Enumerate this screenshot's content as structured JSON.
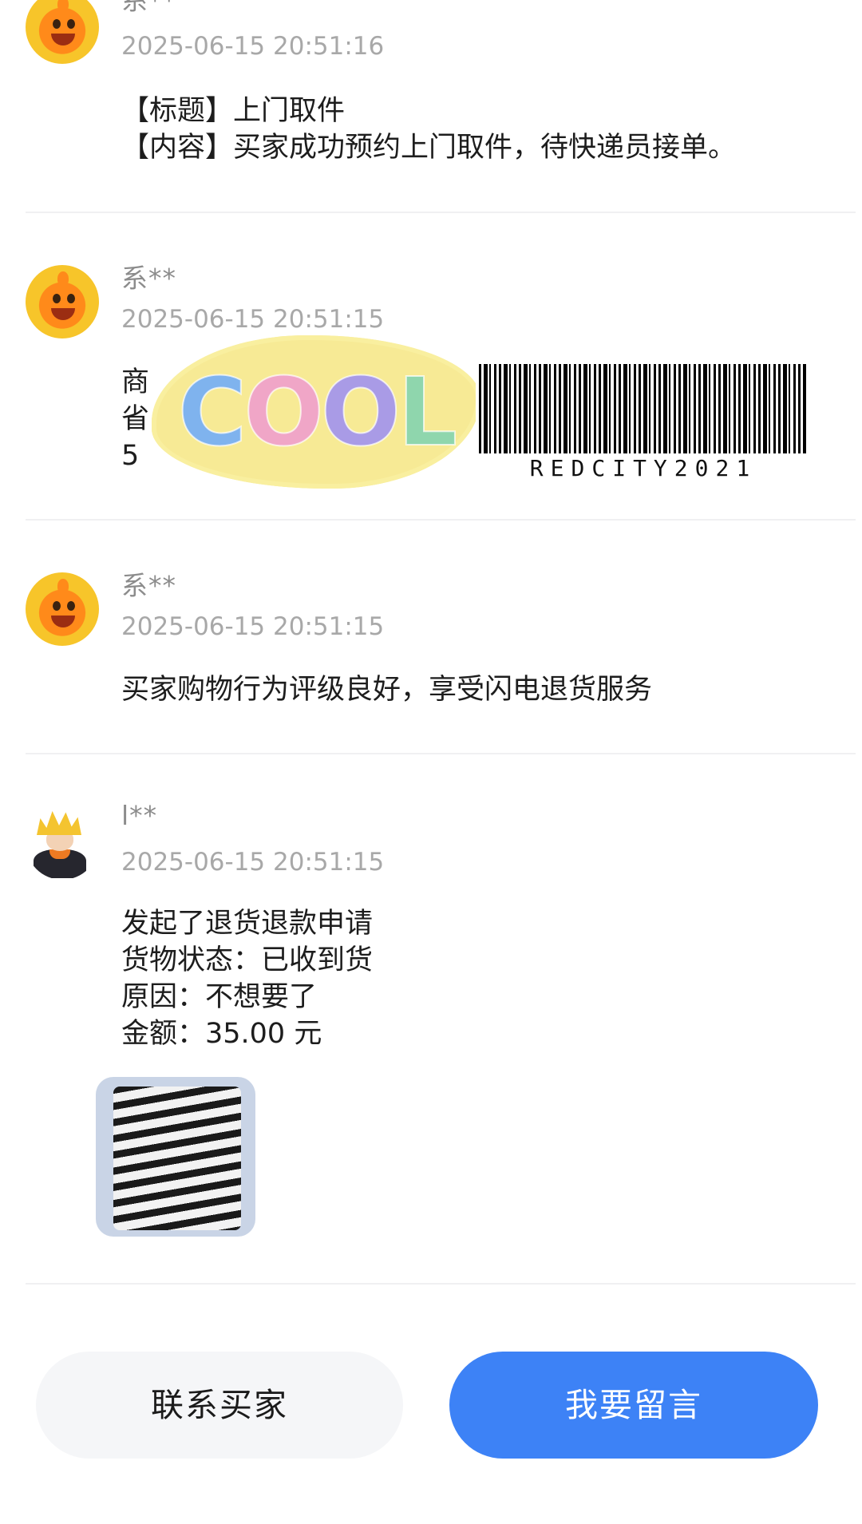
{
  "messages": [
    {
      "sender": "系**",
      "time": "2025-06-15 20:51:16",
      "lines": [
        "【标题】上门取件",
        "【内容】买家成功预约上门取件，待快递员接单。"
      ],
      "avatar": "orange-mascot-icon"
    },
    {
      "sender": "系**",
      "time": "2025-06-15 20:51:15",
      "lines": [
        "商",
        "省",
        "5"
      ],
      "avatar": "orange-mascot-icon"
    },
    {
      "sender": "系**",
      "time": "2025-06-15 20:51:15",
      "lines": [
        "买家购物行为评级良好，享受闪电退货服务"
      ],
      "avatar": "orange-mascot-icon"
    },
    {
      "sender": "l**",
      "time": "2025-06-15 20:51:15",
      "lines": [
        "发起了退货退款申请",
        "货物状态：已收到货",
        "原因：不想要了",
        "金额：35.00 元"
      ],
      "avatar": "ninja-avatar-icon"
    }
  ],
  "overlay": {
    "sticker_text": [
      "C",
      "O",
      "O",
      "L"
    ],
    "barcode_text": "REDCITY2021"
  },
  "actions": {
    "contact_buyer": "联系买家",
    "leave_message": "我要留言"
  },
  "colors": {
    "primary_button": "#3d82f6",
    "secondary_button": "#f5f6f8",
    "timestamp": "#a8a8a8"
  }
}
